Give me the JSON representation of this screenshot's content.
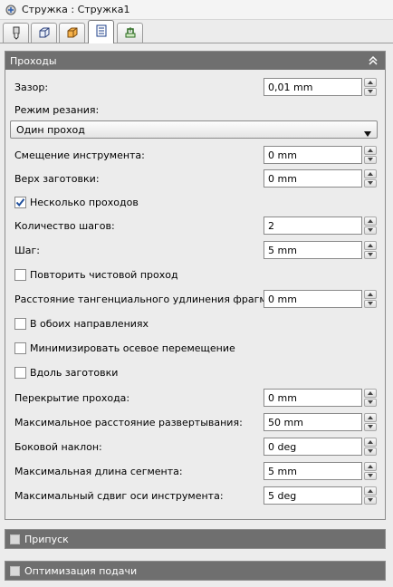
{
  "window": {
    "title": "Стружка : Стружка1"
  },
  "tabs": [
    {
      "icon": "tool-icon"
    },
    {
      "icon": "box-wireframe-icon"
    },
    {
      "icon": "stock-icon"
    },
    {
      "icon": "passes-icon",
      "active": true
    },
    {
      "icon": "linking-icon"
    }
  ],
  "passes_panel": {
    "title": "Проходы",
    "gap": {
      "label": "Зазор:",
      "value": "0,01 mm"
    },
    "cut_mode": {
      "label": "Режим резания:",
      "value": "Один проход"
    },
    "tool_offset": {
      "label": "Смещение инструмента:",
      "value": "0 mm"
    },
    "stock_top": {
      "label": "Верх заготовки:",
      "value": "0 mm"
    },
    "multiple_passes": {
      "label": "Несколько проходов",
      "checked": true
    },
    "step_count": {
      "label": "Количество шагов:",
      "value": "2"
    },
    "step": {
      "label": "Шаг:",
      "value": "5 mm"
    },
    "repeat_finish": {
      "label": "Повторить чистовой проход",
      "checked": false
    },
    "tangential_ext": {
      "label": "Расстояние тангенциального удлинения фрагмента:",
      "value": "0 mm"
    },
    "both_dirs": {
      "label": "В обоих направлениях",
      "checked": false
    },
    "min_axial": {
      "label": "Минимизировать осевое перемещение",
      "checked": false
    },
    "along_stock": {
      "label": "Вдоль заготовки",
      "checked": false
    },
    "pass_overlap": {
      "label": "Перекрытие прохода:",
      "value": "0 mm"
    },
    "max_unroll": {
      "label": "Максимальное расстояние развертывания:",
      "value": "50 mm"
    },
    "side_tilt": {
      "label": "Боковой наклон:",
      "value": "0 deg"
    },
    "max_segment": {
      "label": "Максимальная длина сегмента:",
      "value": "5 mm"
    },
    "max_axis_shift": {
      "label": "Максимальный сдвиг оси инструмента:",
      "value": "5 deg"
    }
  },
  "allowance_panel": {
    "title": "Припуск"
  },
  "feed_panel": {
    "title": "Оптимизация подачи"
  },
  "colors": {
    "header_bg": "#6f6f6f",
    "background": "#ececec",
    "check_blue": "#1f4f9c"
  }
}
